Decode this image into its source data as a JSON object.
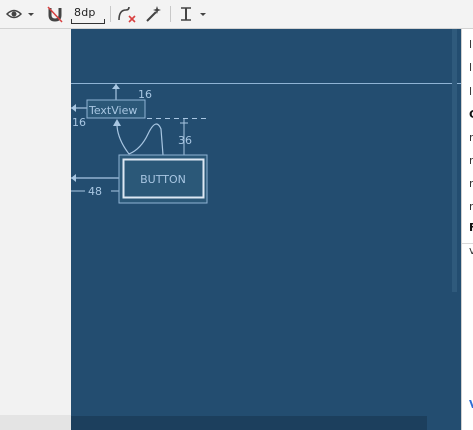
{
  "toolbar": {
    "default_margin": "8dp",
    "icons": [
      "eye-icon",
      "dropdown-arrow-icon",
      "magnet-icon",
      "clear-constraints-icon",
      "infer-constraints-icon",
      "guidelines-icon"
    ]
  },
  "canvas": {
    "textview_label": "TextView",
    "button_label": "BUTTON",
    "margin_top": "16",
    "margin_left": "16",
    "margin_button_left": "48",
    "margin_button_top": "36"
  },
  "attributes_panel": {
    "lines": [
      {
        "text": "l",
        "style": "normal"
      },
      {
        "text": "l",
        "style": "normal"
      },
      {
        "text": "l",
        "style": "normal"
      },
      {
        "text": "C",
        "style": "bold"
      },
      {
        "text": "r",
        "style": "normal"
      },
      {
        "text": "r",
        "style": "normal"
      },
      {
        "text": "r",
        "style": "normal"
      },
      {
        "text": "r",
        "style": "normal"
      },
      {
        "text": "F",
        "style": "bold"
      },
      {
        "text": "v",
        "style": "normal"
      }
    ],
    "footer_link": "V"
  },
  "colors": {
    "blueprint_bg": "#234d70",
    "blueprint_line": "#a8c6e2",
    "toolbar_bg": "#f3f3f3",
    "accent_red": "#d84040",
    "accent_blue": "#2f6fd6"
  }
}
